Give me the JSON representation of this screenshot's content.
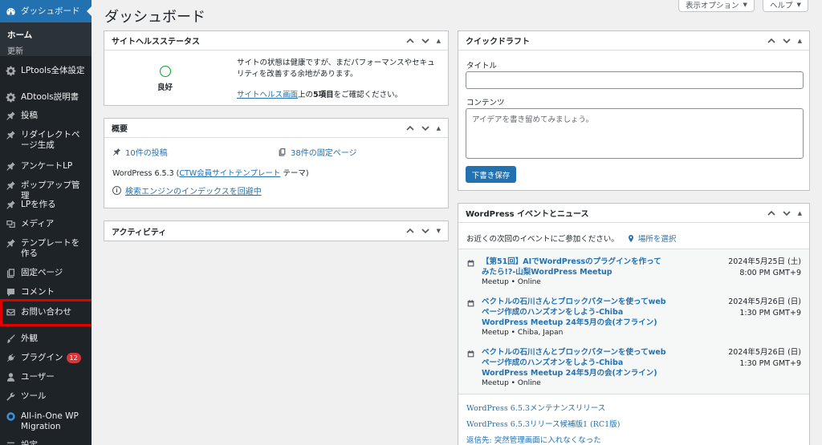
{
  "sidebar": {
    "dashboard": "ダッシュボード",
    "home": "ホーム",
    "updates": "更新",
    "items": [
      {
        "label": "LPtools全体設定",
        "icon": "gear-icon"
      },
      {
        "label": "ADtools説明書",
        "icon": "gear-icon"
      },
      {
        "label": "投稿",
        "icon": "pin-icon"
      },
      {
        "label": "リダイレクトページ生成",
        "icon": "pin-icon"
      },
      {
        "label": "アンケートLP",
        "icon": "pin-icon"
      },
      {
        "label": "ポップアップ管理",
        "icon": "pin-icon"
      },
      {
        "label": "LPを作る",
        "icon": "pin-icon"
      },
      {
        "label": "メディア",
        "icon": "media-icon"
      },
      {
        "label": "テンプレートを作る",
        "icon": "pin-icon"
      },
      {
        "label": "固定ページ",
        "icon": "page-icon"
      },
      {
        "label": "コメント",
        "icon": "comment-icon"
      },
      {
        "label": "お問い合わせ",
        "icon": "mail-icon"
      },
      {
        "label": "外観",
        "icon": "brush-icon"
      },
      {
        "label": "プラグイン",
        "icon": "plugin-icon",
        "badge": "12"
      },
      {
        "label": "ユーザー",
        "icon": "user-icon"
      },
      {
        "label": "ツール",
        "icon": "wrench-icon"
      },
      {
        "label": "All-in-One WP Migration",
        "icon": "migration-icon"
      },
      {
        "label": "設定",
        "icon": "settings-icon"
      }
    ]
  },
  "header": {
    "title": "ダッシュボード",
    "screen_options": "表示オプション",
    "help": "ヘルプ"
  },
  "site_health": {
    "title": "サイトヘルスステータス",
    "status": "良好",
    "message": "サイトの状態は健康ですが、まだパフォーマンスやセキュリティを改善する余地があります。",
    "link": "サイトヘルス画面",
    "suffix_a": "上の",
    "items": "5項目",
    "suffix_b": "をご確認ください。"
  },
  "overview": {
    "title": "概要",
    "posts": "10件の投稿",
    "pages": "38件の固定ページ",
    "version_prefix": "WordPress 6.5.3 (",
    "theme": "CTW会員サイトテンプレート",
    "version_suffix": " テーマ)",
    "search_engine": "検索エンジンのインデックスを回避中"
  },
  "activity": {
    "title": "アクティビティ"
  },
  "quick_draft": {
    "title": "クイックドラフト",
    "title_label": "タイトル",
    "title_value": "",
    "content_label": "コンテンツ",
    "content_placeholder": "アイデアを書き留めてみましょう。",
    "save": "下書き保存"
  },
  "events": {
    "title": "WordPress イベントとニュース",
    "intro": "お近くの次回のイベントにご参加ください。",
    "location_link": "場所を選択",
    "list": [
      {
        "title": "【第51回】AIでWordPressのプラグインを作ってみたら!?-山梨WordPress Meetup",
        "meta": "Meetup • Online",
        "date": "2024年5月25日 (土)",
        "time": "8:00 PM GMT+9"
      },
      {
        "title": "ベクトルの石川さんとブロックパターンを使ってwebページ作成のハンズオンをしよう-Chiba WordPress Meetup 24年5月の会(オフライン)",
        "meta": "Meetup • Chiba, Japan",
        "date": "2024年5月26日 (日)",
        "time": "1:30 PM GMT+9"
      },
      {
        "title": "ベクトルの石川さんとブロックパターンを使ってwebページ作成のハンズオンをしよう-Chiba WordPress Meetup 24年5月の会(オンライン)",
        "meta": "Meetup • Online",
        "date": "2024年5月26日 (日)",
        "time": "1:30 PM GMT+9"
      }
    ],
    "news": [
      "WordPress 6.5.3メンテナンスリリース",
      "WordPress 6.5.3リリース候補版1 (RC1版)",
      "返信先: 突然管理画面に入れなくなった"
    ]
  },
  "colors": {
    "sidebar_bg": "#1d2327",
    "accent": "#2271b1",
    "highlight": "#e00000",
    "health_ok": "#00a32a"
  }
}
